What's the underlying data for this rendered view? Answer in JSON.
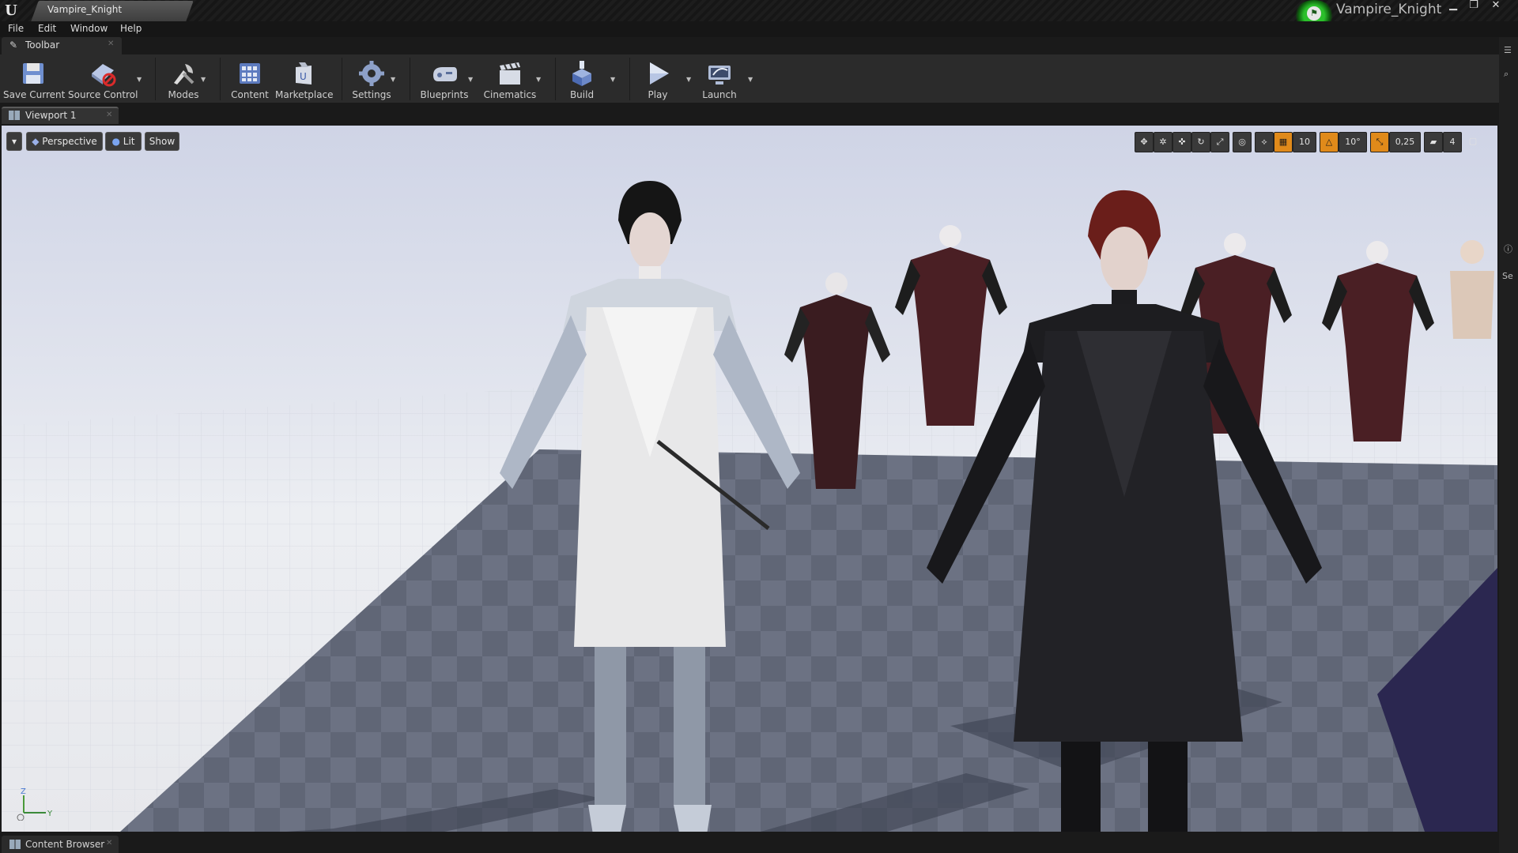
{
  "window": {
    "tab_title": "Vampire_Knight",
    "project_name": "Vampire_Knight",
    "logo": "unreal-logo",
    "controls": [
      "minimize-icon",
      "restore-icon",
      "close-icon"
    ]
  },
  "menu": {
    "items": [
      "File",
      "Edit",
      "Window",
      "Help"
    ]
  },
  "toolbar_tab": {
    "label": "Toolbar",
    "icon": "wrench-icon"
  },
  "toolbar": {
    "tools": [
      {
        "label": "Save Current",
        "icon": "save-icon"
      },
      {
        "label": "Source Control",
        "icon": "source-control-icon"
      },
      {
        "label": "Modes",
        "icon": "modes-icon"
      },
      {
        "label": "Content",
        "icon": "content-icon"
      },
      {
        "label": "Marketplace",
        "icon": "marketplace-icon"
      },
      {
        "label": "Settings",
        "icon": "settings-icon"
      },
      {
        "label": "Blueprints",
        "icon": "blueprints-icon"
      },
      {
        "label": "Cinematics",
        "icon": "cinematics-icon"
      },
      {
        "label": "Build",
        "icon": "build-icon"
      },
      {
        "label": "Play",
        "icon": "play-icon"
      },
      {
        "label": "Launch",
        "icon": "launch-icon"
      }
    ]
  },
  "viewport_tab": {
    "label": "Viewport 1",
    "icon": "viewport-icon"
  },
  "viewport": {
    "view_mode": "Perspective",
    "lighting": "Lit",
    "show": "Show",
    "grid_snap": "10",
    "rotation_snap": "10°",
    "scale_snap": "0,25",
    "camera_speed": "4",
    "accent_color": "#e08a1a"
  },
  "bottom_tab": {
    "label": "Content Browser",
    "icon": "content-browser-icon"
  },
  "right_edge": {
    "label": "Se"
  }
}
